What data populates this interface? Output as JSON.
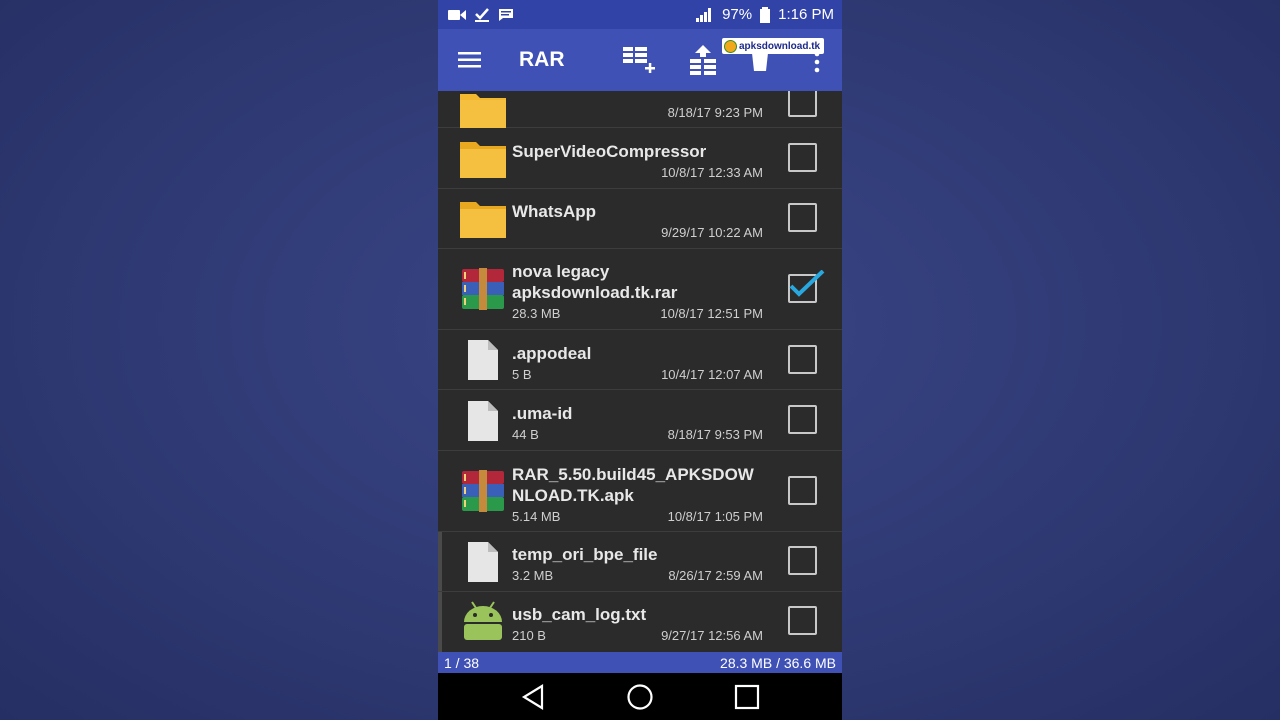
{
  "status_bar": {
    "battery": "97%",
    "time": "1:16 PM",
    "icons": [
      "video-camera-icon",
      "checklist-icon",
      "message-icon",
      "signal-icon",
      "battery-icon"
    ]
  },
  "toolbar": {
    "title": "RAR",
    "icons": [
      "menu-icon",
      "add-to-archive-icon",
      "extract-icon",
      "delete-icon",
      "more-vert-icon"
    ],
    "watermark": "apksdownload.tk"
  },
  "files": [
    {
      "name": "",
      "size": "",
      "date": "8/18/17 9:23 PM",
      "type": "folder",
      "checked": false
    },
    {
      "name": "SuperVideoCompressor",
      "size": "",
      "date": "10/8/17 12:33 AM",
      "type": "folder",
      "checked": false
    },
    {
      "name": "WhatsApp",
      "size": "",
      "date": "9/29/17 10:22 AM",
      "type": "folder",
      "checked": false
    },
    {
      "name_line1": "nova legacy",
      "name_line2": "apksdownload.tk.rar",
      "size": "28.3 MB",
      "date": "10/8/17 12:51 PM",
      "type": "rar",
      "checked": true
    },
    {
      "name": ".appodeal",
      "size": "5 B",
      "date": "10/4/17 12:07 AM",
      "type": "file",
      "checked": false
    },
    {
      "name": ".uma-id",
      "size": "44 B",
      "date": "8/18/17 9:53 PM",
      "type": "file",
      "checked": false
    },
    {
      "name_line1": "RAR_5.50.build45_APKSDOW",
      "name_line2": "NLOAD.TK.apk",
      "size": "5.14 MB",
      "date": "10/8/17 1:05 PM",
      "type": "rar",
      "checked": false
    },
    {
      "name": "temp_ori_bpe_file",
      "size": "3.2 MB",
      "date": "8/26/17 2:59 AM",
      "type": "file",
      "checked": false
    },
    {
      "name": "usb_cam_log.txt",
      "size": "210 B",
      "date": "9/27/17 12:56 AM",
      "type": "android",
      "checked": false
    }
  ],
  "info_bar": {
    "selection": "1 / 38",
    "size_summary": "28.3 MB / 36.6 MB"
  },
  "colors": {
    "background": "#2f3a74",
    "toolbar": "#3f51b5",
    "status_bar": "#3243a8",
    "list_bg": "#2b2b2b",
    "folder": "#f2b830",
    "check_accent": "#29a8e0"
  }
}
